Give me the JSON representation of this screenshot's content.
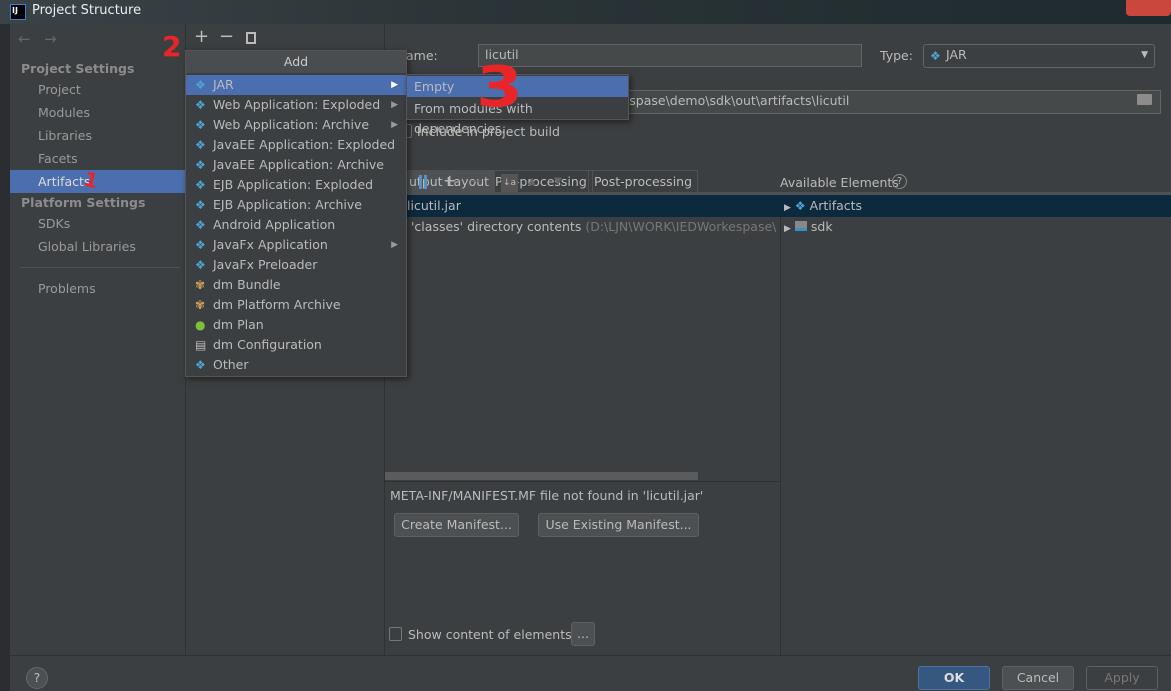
{
  "window": {
    "title": "Project Structure",
    "logo": "IJ"
  },
  "sidebar": {
    "back": "←",
    "forward": "→",
    "project_settings": "Project Settings",
    "items": [
      "Project",
      "Modules",
      "Libraries",
      "Facets",
      "Artifacts"
    ],
    "platform_settings": "Platform Settings",
    "platform_items": [
      "SDKs",
      "Global Libraries"
    ],
    "problems": "Problems"
  },
  "toolbar": {
    "add": "+",
    "remove": "−",
    "copy": "copy-icon"
  },
  "add_menu": {
    "title": "Add",
    "items": [
      {
        "label": "JAR",
        "icon": "jar-icon",
        "submenu": true
      },
      {
        "label": "Web Application: Exploded",
        "icon": "web-icon",
        "submenu": true
      },
      {
        "label": "Web Application: Archive",
        "icon": "web-icon",
        "submenu": true
      },
      {
        "label": "JavaEE Application: Exploded",
        "icon": "javaee-icon",
        "submenu": false
      },
      {
        "label": "JavaEE Application: Archive",
        "icon": "javaee-icon",
        "submenu": false
      },
      {
        "label": "EJB Application: Exploded",
        "icon": "ejb-icon",
        "submenu": false
      },
      {
        "label": "EJB Application: Archive",
        "icon": "ejb-icon",
        "submenu": false
      },
      {
        "label": "Android Application",
        "icon": "android-icon",
        "submenu": false
      },
      {
        "label": "JavaFx Application",
        "icon": "javafx-icon",
        "submenu": true
      },
      {
        "label": "JavaFx Preloader",
        "icon": "javafx-icon",
        "submenu": false
      },
      {
        "label": "dm Bundle",
        "icon": "dm-bundle-icon",
        "submenu": false
      },
      {
        "label": "dm Platform Archive",
        "icon": "dm-bundle-icon",
        "submenu": false
      },
      {
        "label": "dm Plan",
        "icon": "dm-plan-icon",
        "submenu": false
      },
      {
        "label": "dm Configuration",
        "icon": "dm-config-icon",
        "submenu": false
      },
      {
        "label": "Other",
        "icon": "other-icon",
        "submenu": false
      }
    ]
  },
  "jar_submenu": {
    "items": [
      "Empty",
      "From modules with dependencies..."
    ]
  },
  "artifact": {
    "name_label": "ame:",
    "name": "licutil",
    "type_label": "Type:",
    "type": "JAR",
    "output_dir": "orkespase\\demo\\sdk\\out\\artifacts\\licutil",
    "include_label": "Include in project build",
    "include_checked": false
  },
  "tabs": [
    "utput Layout",
    "Pre-processing",
    "Post-processing"
  ],
  "layout_tree": {
    "root": "licutil.jar",
    "child": "'classes' directory contents",
    "child_path": "(D:\\LJN\\WORK\\IEDWorkespase\\d"
  },
  "available": {
    "label": "Available Elements",
    "items": [
      "Artifacts",
      "sdk"
    ]
  },
  "manifest": {
    "message": "META-INF/MANIFEST.MF file not found in 'licutil.jar'",
    "create": "Create Manifest...",
    "use_existing": "Use Existing Manifest..."
  },
  "show_content": {
    "label": "Show content of elements",
    "checked": false,
    "more": "..."
  },
  "footer": {
    "help": "?",
    "ok": "OK",
    "cancel": "Cancel",
    "apply": "Apply"
  },
  "annotations": [
    "1",
    "2",
    "3"
  ],
  "colors": {
    "selection": "#4b6eaf",
    "accent_ok": "#365880",
    "annotation": "#e8262a",
    "tree_selected": "#0d293e"
  }
}
